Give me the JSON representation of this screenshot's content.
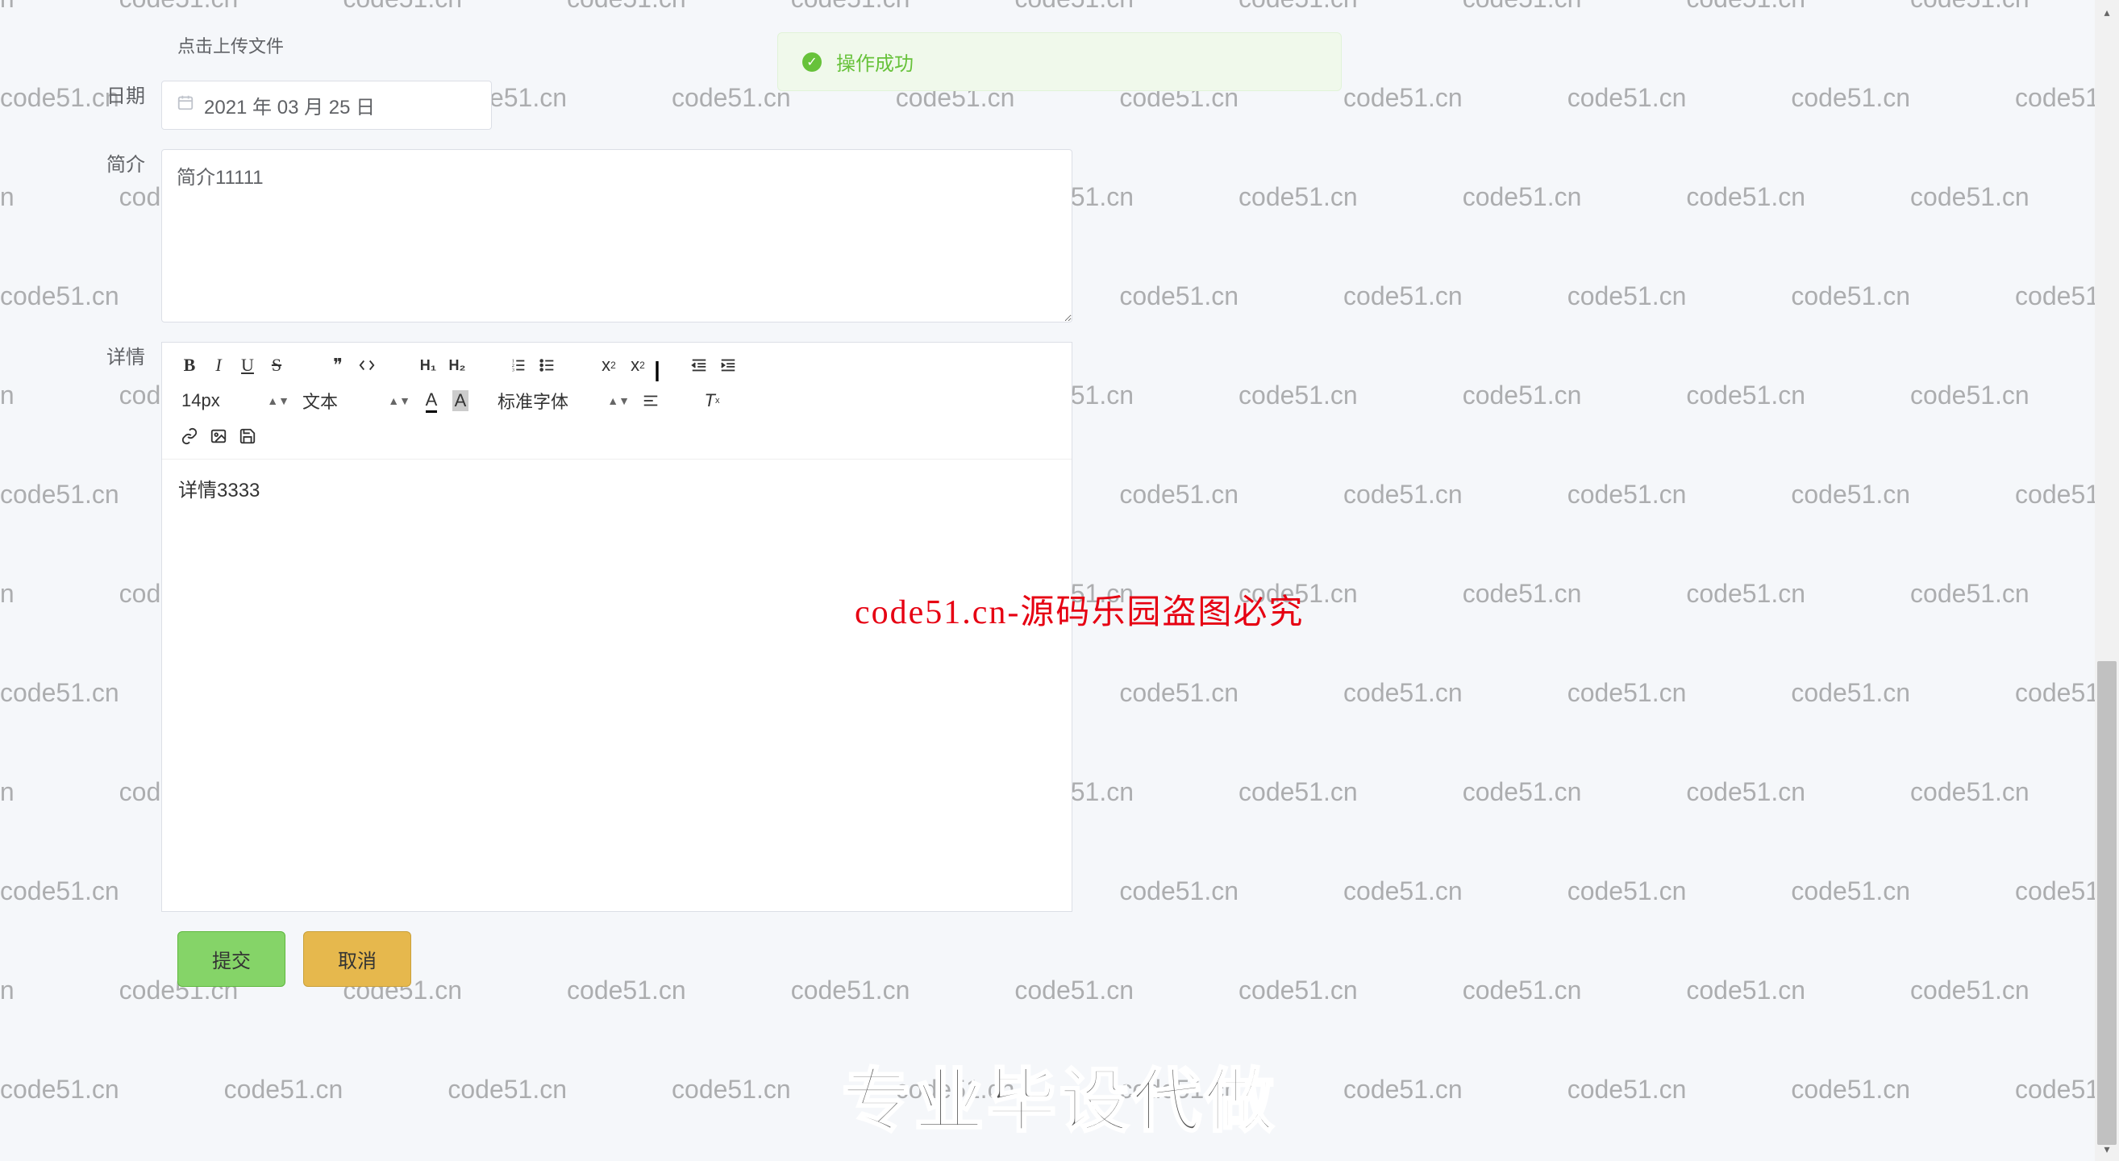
{
  "watermark": "code51.cn",
  "toast": {
    "text": "操作成功"
  },
  "upload": {
    "link_text": "点击上传文件"
  },
  "form": {
    "date_label": "日期",
    "date_value": "2021 年 03 月 25 日",
    "intro_label": "简介",
    "intro_value": "简介11111",
    "detail_label": "详情",
    "detail_value": "详情3333"
  },
  "editor_toolbar": {
    "font_size": "14px",
    "block_type": "文本",
    "font_family": "标准字体"
  },
  "buttons": {
    "submit": "提交",
    "cancel": "取消"
  },
  "overlays": {
    "red_text": "code51.cn-源码乐园盗图必究",
    "big_text": "专业毕设代做"
  }
}
